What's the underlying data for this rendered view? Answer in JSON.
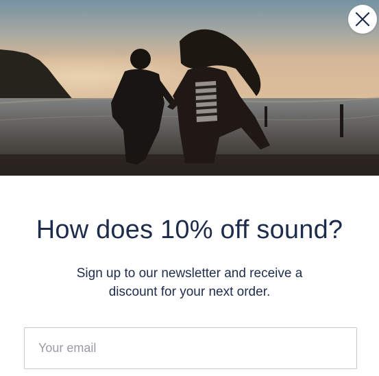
{
  "popup": {
    "close_icon": "close-icon",
    "hero_image": "sunset-beach-photo",
    "headline": "How does 10% off sound?",
    "subtext": "Sign up to our newsletter and receive a discount for your next order.",
    "email_placeholder": "Your email",
    "colors": {
      "headline": "#1d2c4c",
      "input_border": "#c7c7cc",
      "placeholder": "#9a9aa3"
    }
  }
}
